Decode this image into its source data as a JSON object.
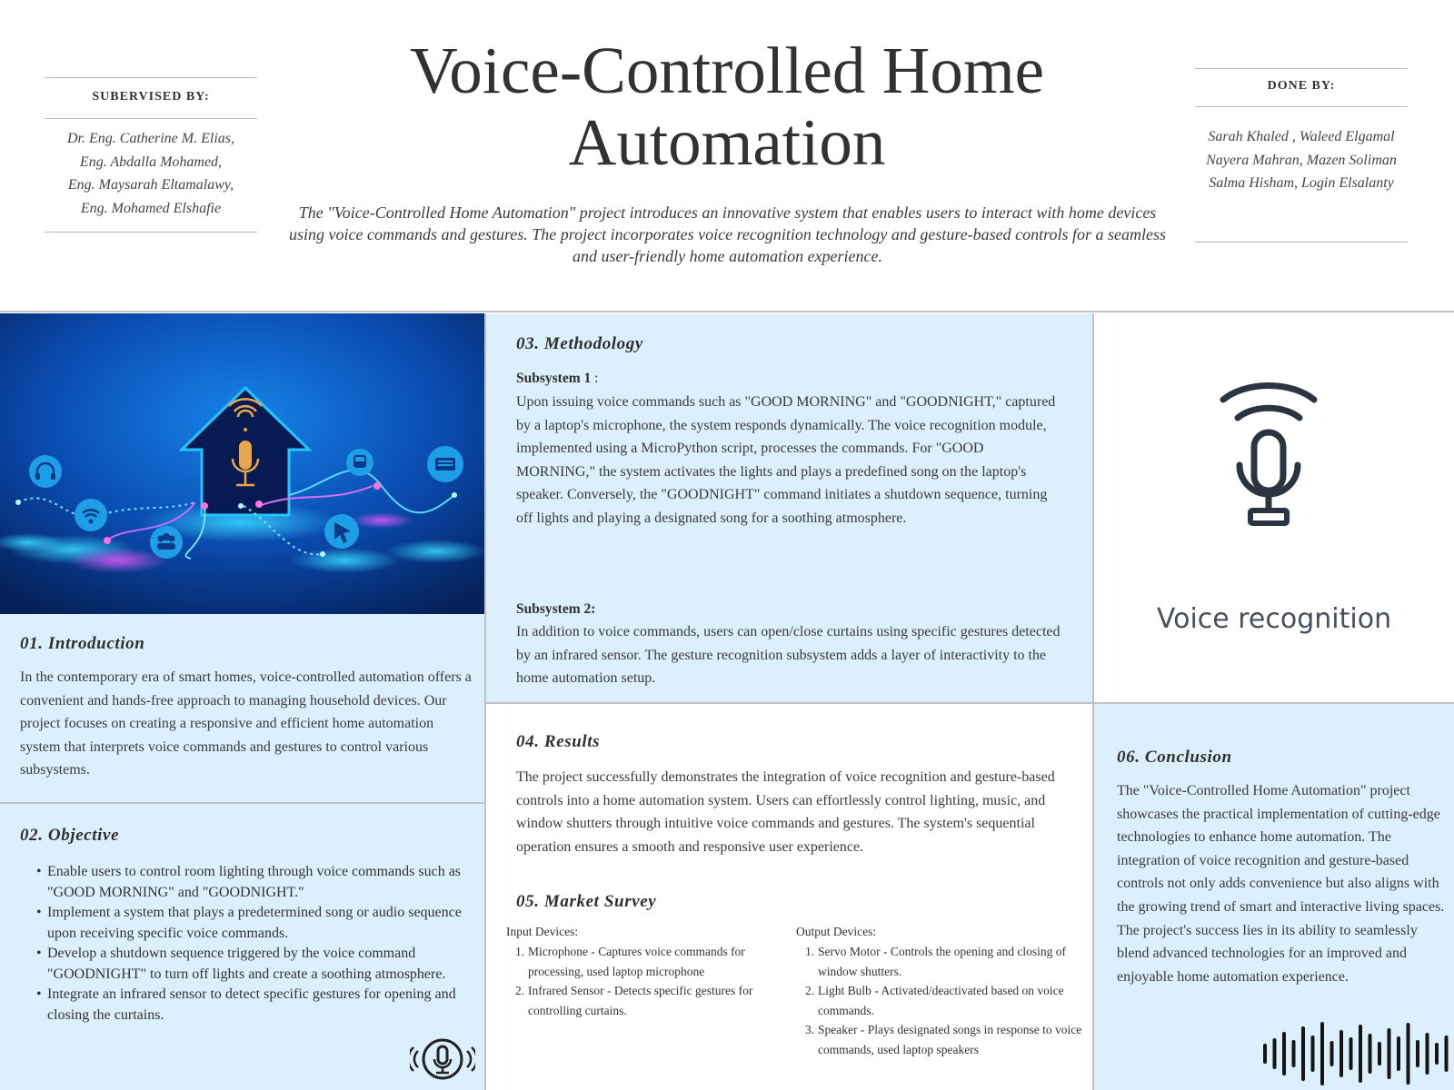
{
  "header": {
    "title": "Voice-Controlled Home Automation",
    "summary": "The \"Voice-Controlled Home Automation\" project introduces an innovative system that enables users to interact with home devices using voice commands and gestures. The project incorporates voice recognition technology and gesture-based controls for a seamless and user-friendly home automation experience.",
    "supervised_label": "SUBERVISED BY:",
    "supervisors": [
      "Dr. Eng. Catherine M. Elias,",
      "Eng. Abdalla Mohamed,",
      "Eng. Maysarah Eltamalawy,",
      "Eng. Mohamed Elshafie"
    ],
    "done_label": "DONE BY:",
    "team": [
      "Sarah Khaled , Waleed Elgamal",
      "Nayera Mahran, Mazen Soliman",
      "Salma Hisham, Login Elsalanty"
    ]
  },
  "introduction": {
    "number": "01.",
    "title": "Introduction",
    "text": "In the contemporary era of smart homes, voice-controlled automation offers a convenient and hands-free approach to managing household devices. Our project focuses on creating a responsive and efficient home automation system that interprets voice commands and gestures to control various subsystems."
  },
  "objective": {
    "number": "02.",
    "title": "Objective",
    "items": [
      "Enable users to control room lighting through voice commands such as \"GOOD MORNING\" and \"GOODNIGHT.\"",
      "Implement a system that plays a predetermined song or audio sequence upon receiving specific voice commands.",
      "Develop a shutdown sequence triggered by the voice command \"GOODNIGHT\" to turn off lights and create a soothing atmosphere.",
      "Integrate an infrared sensor to detect specific gestures for opening and closing the curtains."
    ]
  },
  "methodology": {
    "number": "03.",
    "title": "Methodology",
    "sub1_title": "Subsystem 1",
    "sub1_colon": " :",
    "sub1_text": "Upon issuing voice commands such as \"GOOD MORNING\" and \"GOODNIGHT,\" captured by a laptop's microphone, the system responds dynamically. The voice recognition module, implemented using a MicroPython script, processes the commands. For \"GOOD MORNING,\" the system activates the lights and plays a predefined song on the laptop's speaker. Conversely, the \"GOODNIGHT\" command initiates a shutdown sequence, turning off lights and playing a designated song for a soothing atmosphere.",
    "sub2_title": "Subsystem 2:",
    "sub2_text": "In addition to voice commands, users can open/close curtains using specific gestures detected by an infrared sensor. The gesture recognition subsystem adds a layer of interactivity to the home automation setup."
  },
  "voice_card": {
    "label": "Voice recognition"
  },
  "results": {
    "number": "04.",
    "title": "Results",
    "text": "The project successfully demonstrates the integration of voice recognition and gesture-based controls into a home automation system. Users can effortlessly control lighting, music, and window shutters through intuitive voice commands and gestures. The system's sequential operation ensures a smooth and responsive user experience."
  },
  "market": {
    "number": "05.",
    "title": "Market Survey",
    "input_label": "Input Devices:",
    "inputs": [
      "Microphone - Captures voice commands for processing, used laptop microphone",
      "Infrared Sensor - Detects specific gestures for controlling curtains."
    ],
    "output_label": "Output Devices:",
    "outputs": [
      "Servo Motor - Controls the opening and closing of window shutters.",
      "Light Bulb - Activated/deactivated based on voice commands.",
      "Speaker - Plays designated songs in response to voice commands, used laptop speakers"
    ]
  },
  "conclusion": {
    "number": "06.",
    "title": "Conclusion",
    "text": "The \"Voice-Controlled Home Automation\" project showcases the practical implementation of cutting-edge technologies to enhance home automation. The integration of voice recognition and gesture-based controls not only adds convenience but also aligns with the growing trend of smart and interactive living spaces. The project's success lies in its ability to seamlessly blend advanced technologies for an improved and enjoyable home automation experience."
  },
  "colors": {
    "panel": "#dbeffc",
    "title": "#343230",
    "hero_dark": "#06245f",
    "hero_glow": "#1fb6f5",
    "accent_gold": "#e9a64a"
  },
  "icons": [
    "house-mic-icon",
    "headphones-icon",
    "wifi-icon",
    "people-icon",
    "cursor-icon",
    "bus-icon",
    "keyboard-icon",
    "broadcast-mic-icon",
    "sound-wave-icon",
    "small-mic-icon"
  ]
}
